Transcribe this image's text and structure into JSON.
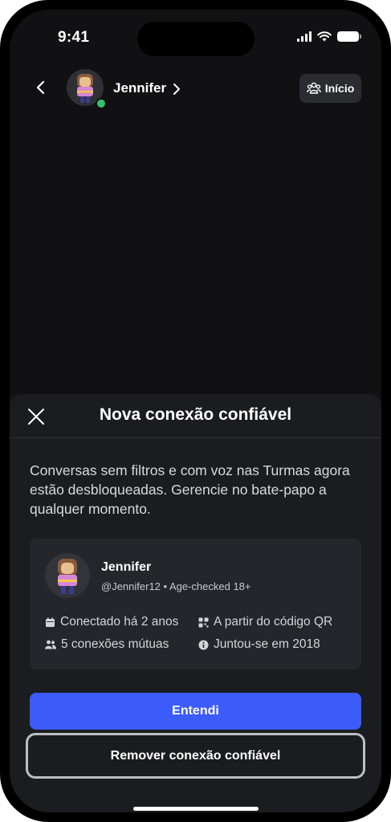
{
  "status_bar": {
    "time": "9:41"
  },
  "chat_header": {
    "contact_name": "Jennifer",
    "home_button_label": "Início"
  },
  "sheet": {
    "title": "Nova conexão confiável",
    "description": "Conversas sem filtros e com voz nas Turmas agora estão desbloqueadas. Gerencie no bate-papo a qualquer momento.",
    "card": {
      "name": "Jennifer",
      "handle": "@Jennifer12 • Age-checked 18+",
      "connected": "Conectado há 2 anos",
      "source": "A partir do código QR",
      "mutual": "5 conexões mútuas",
      "joined": "Juntou-se em 2018"
    },
    "primary_button": "Entendi",
    "secondary_button": "Remover conexão confiável"
  },
  "colors": {
    "accent": "#3b5bfb",
    "online": "#35c06b",
    "background": "#111113",
    "sheet": "#1b1c20"
  },
  "icons": [
    "back-chevron-icon",
    "forward-chevron-icon",
    "friends-icon",
    "close-icon",
    "calendar-icon",
    "qr-code-icon",
    "people-icon",
    "info-icon"
  ]
}
